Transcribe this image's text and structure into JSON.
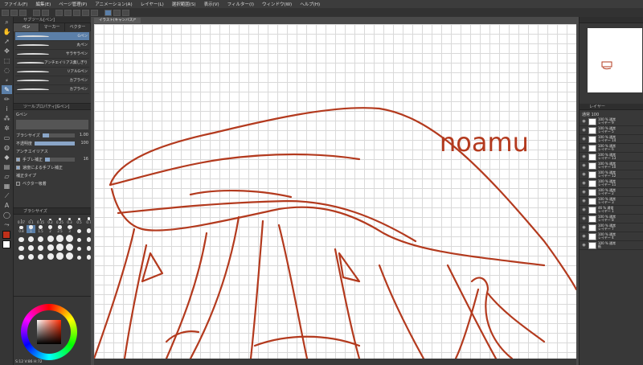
{
  "menubar": {
    "items": [
      "ファイル(F)",
      "編集(E)",
      "ページ管理(P)",
      "アニメーション(A)",
      "レイヤー(L)",
      "選択範囲(S)",
      "表示(V)",
      "フィルター(I)",
      "ウィンドウ(W)",
      "ヘルプ(H)"
    ]
  },
  "subtool": {
    "header": "サブツール[ペン]",
    "tabs": [
      "ペン",
      "マーカー",
      "ベクター"
    ],
    "brushes": [
      "Gペン",
      "丸ペン",
      "サラサラペン",
      "アンチエイリアス無しぎり",
      "リアルGペン",
      "カブラペン",
      "カブラペン"
    ]
  },
  "toolprop": {
    "header": "ツールプロパティ[Gペン]",
    "preview_label": "Gペン",
    "brush_size_label": "ブラシサイズ",
    "brush_size_value": "1.00",
    "opacity_label": "不透明度",
    "opacity_value": "100",
    "antialias_label": "アンチエイリアス",
    "stabilize_label": "手ブレ補正",
    "stabilize_value": "16",
    "speed_label": "速度による手ブレ補正",
    "correction_label": "補正タイプ",
    "vector_label": "ベクター吸着"
  },
  "brushsize": {
    "header": "ブラシサイズ",
    "labels": [
      "0.07",
      "0.1",
      "0.15",
      "0.2",
      "0.25",
      "0.3",
      "0.5",
      "0.7",
      "0.8",
      "1",
      "1.5",
      "2",
      "2.5",
      "3"
    ]
  },
  "colorwheel": {
    "footer": "S:12  V:86  H:72"
  },
  "canvas": {
    "tab_label": "イラスト(キャンバス)*",
    "status_text": "",
    "signature": "noamu"
  },
  "layers": {
    "header": "レイヤー",
    "blend_label": "通常",
    "opacity_label": "100",
    "items": [
      {
        "mode": "100 % 通常",
        "name": "レイヤー 9"
      },
      {
        "mode": "100 % 通常",
        "name": "レイヤー 5"
      },
      {
        "mode": "100 % 通常",
        "name": "レイヤー 14"
      },
      {
        "mode": "100 % 通常",
        "name": "レイヤー 6"
      },
      {
        "mode": "100 % 通常",
        "name": "レイヤー 13"
      },
      {
        "mode": "100 % 通常",
        "name": "レイヤー 10"
      },
      {
        "mode": "100 % 通常",
        "name": "レイヤー 12"
      },
      {
        "mode": "100 % 通常",
        "name": "レイヤー 11"
      },
      {
        "mode": "100 % 通常",
        "name": "レイヤー 2"
      },
      {
        "mode": "100 % 通常",
        "name": "レイヤー 3"
      },
      {
        "mode": "46 % 通常",
        "name": "レイヤー 1"
      },
      {
        "mode": "100 % 通常",
        "name": "レイヤー 8"
      },
      {
        "mode": "100 % 通常",
        "name": "レイヤー 7"
      },
      {
        "mode": "100 % 通常",
        "name": "レイヤー 4"
      },
      {
        "mode": "100 % 通常",
        "name": "紙"
      }
    ]
  },
  "colors": {
    "line": "#b33a1e",
    "accent": "#5b7fa8",
    "main_color": "#c0301a"
  }
}
